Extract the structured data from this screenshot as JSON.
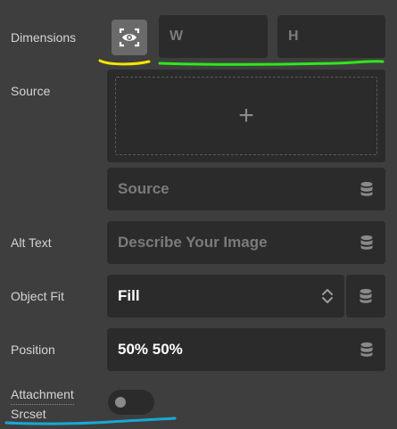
{
  "dimensions": {
    "label": "Dimensions",
    "width_placeholder": "W",
    "height_placeholder": "H"
  },
  "source": {
    "label": "Source",
    "upload_glyph": "+",
    "input_placeholder": "Source"
  },
  "alt_text": {
    "label": "Alt Text",
    "placeholder": "Describe Your Image"
  },
  "object_fit": {
    "label": "Object Fit",
    "selected": "Fill"
  },
  "position": {
    "label": "Position",
    "value": "50% 50%"
  },
  "attachment_srcset": {
    "label_line1": "Attachment",
    "label_line2": "Srcset",
    "enabled": false
  },
  "colors": {
    "background": "#3e3e3e",
    "field": "#2b2b2b",
    "highlight_yellow": "#f2e600",
    "highlight_green": "#2ee81a",
    "highlight_blue": "#16a8d6"
  },
  "icons": {
    "preview": "eye-focus-icon",
    "dynamic_data": "database-icon",
    "select": "chevron-up-down-icon"
  }
}
